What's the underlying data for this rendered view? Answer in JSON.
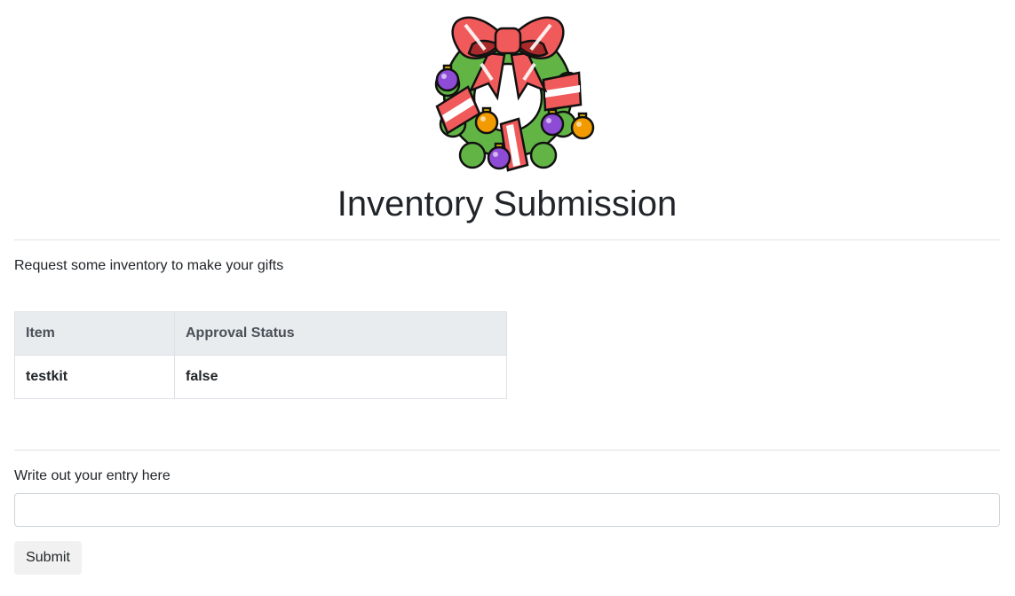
{
  "header": {
    "logo_icon": "christmas-wreath-icon",
    "title": "Inventory Submission"
  },
  "intro": {
    "text": "Request some inventory to make your gifts"
  },
  "inventory_table": {
    "columns": [
      "Item",
      "Approval Status"
    ],
    "rows": [
      [
        "testkit",
        "false"
      ]
    ]
  },
  "entry_form": {
    "label": "Write out your entry here",
    "input_value": "",
    "input_placeholder": "",
    "submit_label": "Submit"
  },
  "colors": {
    "table_header_bg": "#e9ecef",
    "border": "#dee2e6",
    "button_bg": "#f1f1f1",
    "text": "#212529"
  }
}
